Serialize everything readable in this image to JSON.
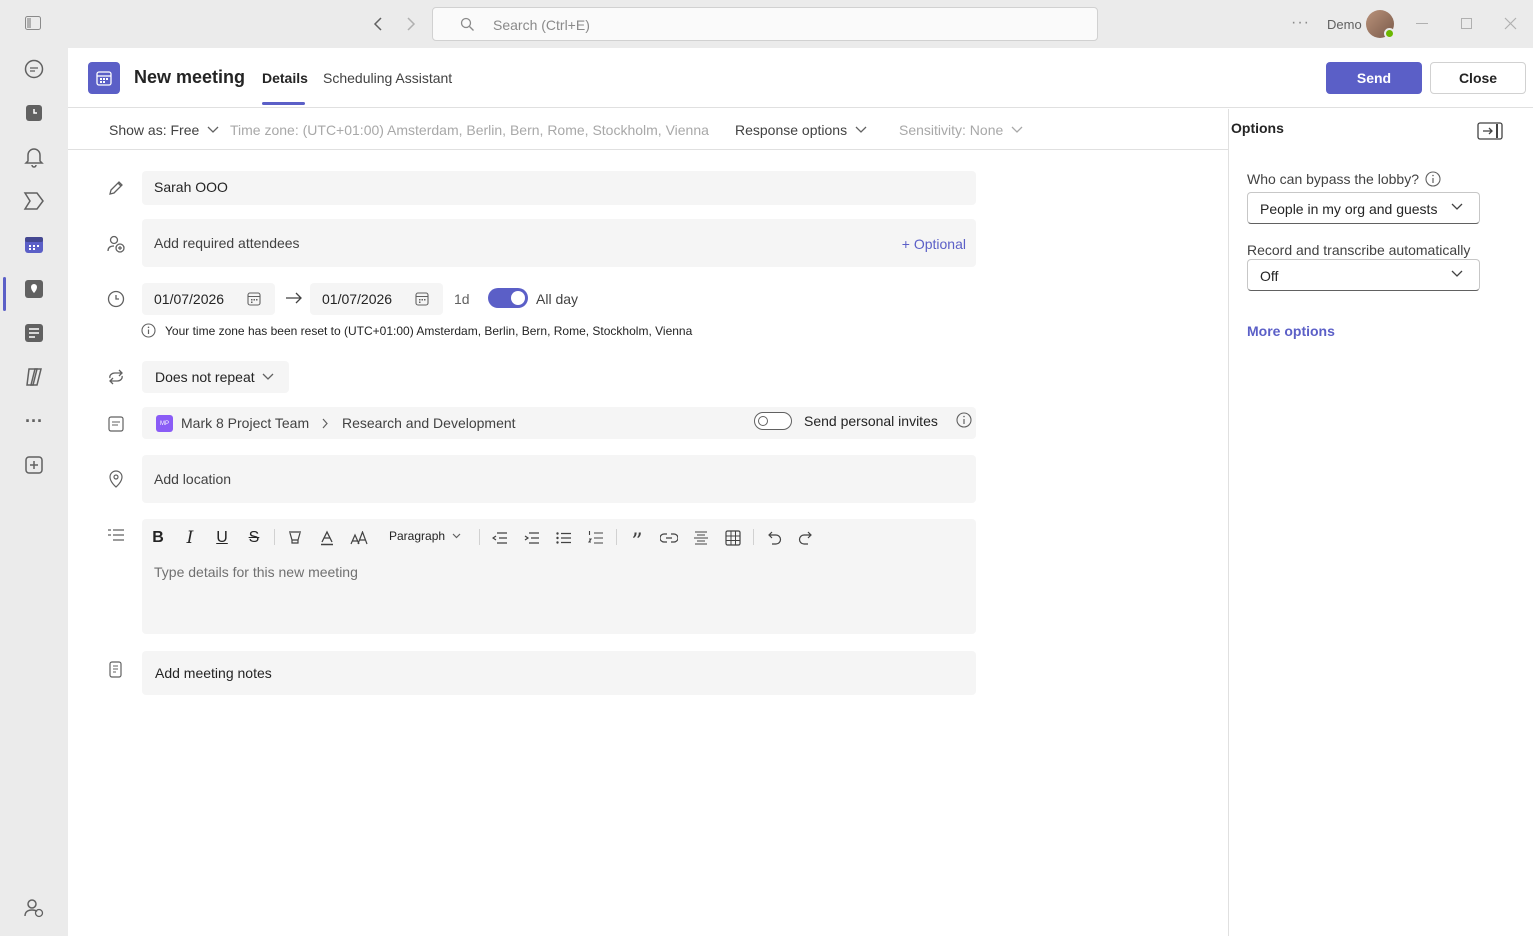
{
  "titlebar": {
    "search_placeholder": "Search (Ctrl+E)",
    "account_name": "Demo"
  },
  "rail": {
    "items": [
      "chat-icon",
      "activity-icon",
      "notifications-icon",
      "teams-icon",
      "calendar-icon",
      "location-icon",
      "notes-icon",
      "copilot-icon",
      "more-icon",
      "add-apps-icon",
      "people-icon"
    ],
    "active": "calendar-icon"
  },
  "header": {
    "title": "New meeting",
    "tabs": [
      {
        "label": "Details",
        "active": true
      },
      {
        "label": "Scheduling Assistant",
        "active": false
      }
    ],
    "send_label": "Send",
    "close_label": "Close"
  },
  "subbar": {
    "show_as": "Show as: Free",
    "timezone": "Time zone: (UTC+01:00) Amsterdam, Berlin, Bern, Rome, Stockholm, Vienna",
    "response_options": "Response options",
    "sensitivity": "Sensitivity: None"
  },
  "form": {
    "title_value": "Sarah OOO",
    "attendees_placeholder": "Add required attendees",
    "optional_label": "+ Optional",
    "start_date": "01/07/2026",
    "end_date": "01/07/2026",
    "duration": "1d",
    "all_day_label": "All day",
    "all_day_on": true,
    "timezone_notice": "Your time zone has been reset to (UTC+01:00) Amsterdam, Berlin, Bern, Rome, Stockholm, Vienna",
    "repeat_label": "Does not repeat",
    "channel_badge": "MP",
    "team_name": "Mark 8 Project Team",
    "channel_name": "Research and Development",
    "personal_invites_label": "Send personal invites",
    "personal_invites_on": false,
    "location_placeholder": "Add location",
    "paragraph_style": "Paragraph",
    "details_placeholder": "Type details for this new meeting",
    "notes_label": "Add meeting notes"
  },
  "options_panel": {
    "title": "Options",
    "lobby_label": "Who can bypass the lobby?",
    "lobby_value": "People in my org and guests",
    "record_label": "Record and transcribe automatically",
    "record_value": "Off",
    "more_options": "More options"
  },
  "colors": {
    "accent": "#5b5fc7",
    "presence": "#6bb700"
  }
}
